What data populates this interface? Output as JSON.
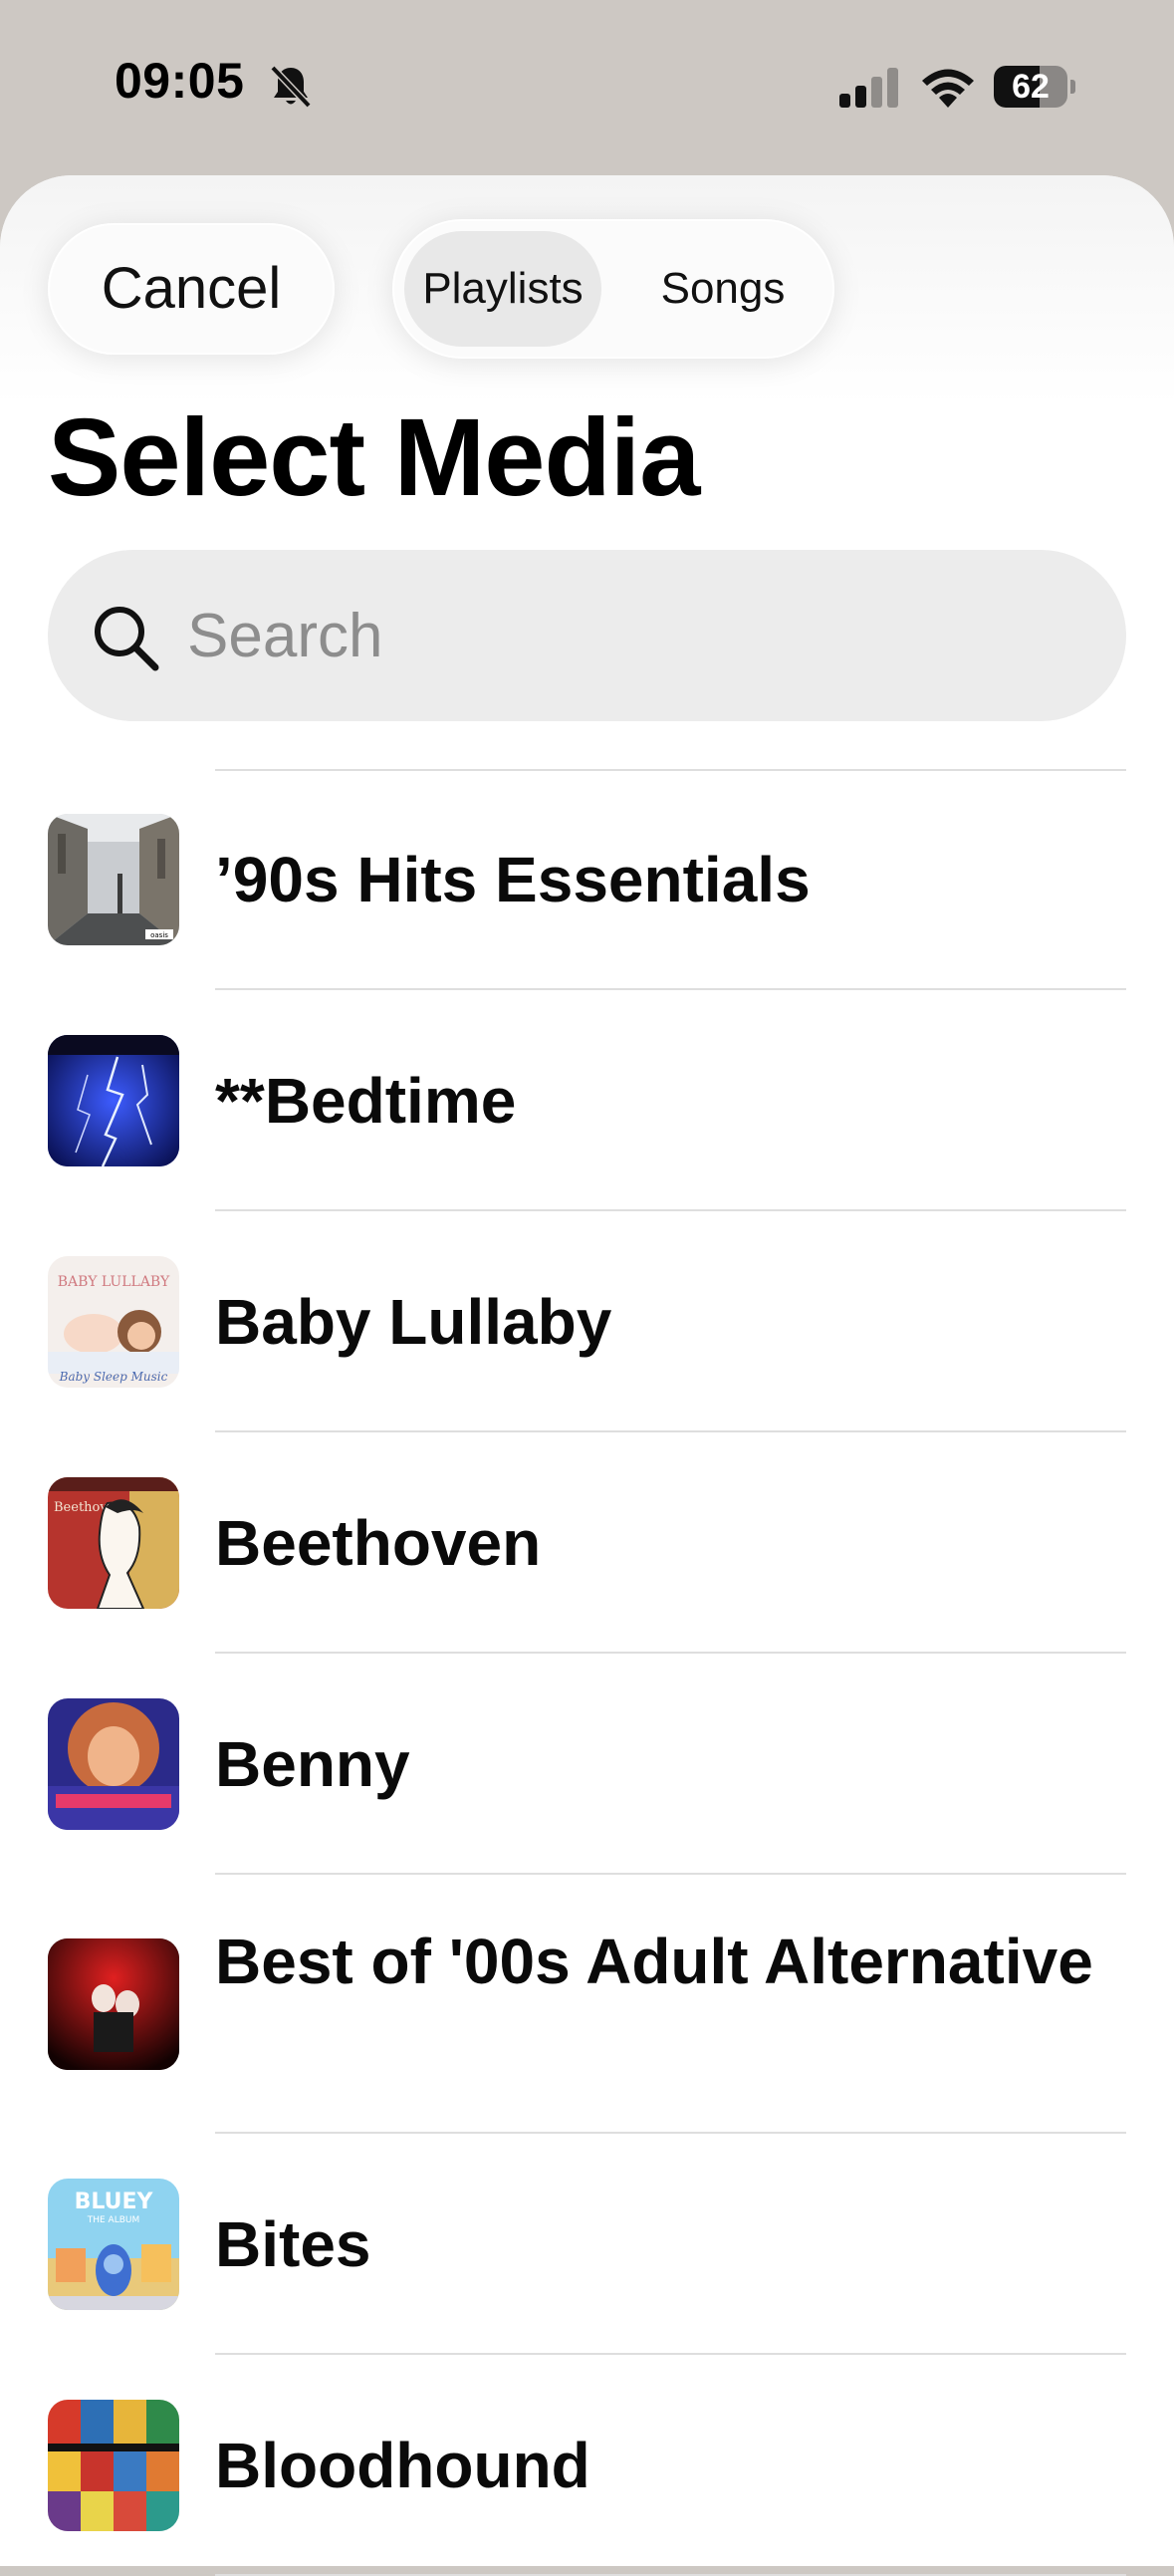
{
  "status_bar": {
    "time": "09:05",
    "battery_level": "62",
    "battery_fraction": 0.62,
    "icons": [
      "bell-slash-icon",
      "cellular-signal-icon",
      "wifi-icon",
      "battery-icon"
    ]
  },
  "header": {
    "cancel_label": "Cancel",
    "segments": [
      {
        "label": "Playlists",
        "selected": true
      },
      {
        "label": "Songs",
        "selected": false
      }
    ],
    "title": "Select Media"
  },
  "search": {
    "placeholder": "Search",
    "value": ""
  },
  "playlists": [
    {
      "title": "’90s Hits Essentials",
      "art": "city-street-photo"
    },
    {
      "title": "**Bedtime",
      "art": "lightning-storm"
    },
    {
      "title": "Baby Lullaby",
      "art": "sleeping-baby",
      "art_text": [
        "BABY LULLABY",
        "Baby Sleep Music"
      ]
    },
    {
      "title": "Beethoven",
      "art": "beethoven-illustration",
      "art_text": [
        "Beethoven"
      ]
    },
    {
      "title": "Benny",
      "art": "portrait-purple"
    },
    {
      "title": "Best of '00s Adult Alternative",
      "art": "red-black-photo"
    },
    {
      "title": "Bites",
      "art": "bluey-cartoon",
      "art_text": [
        "BLUEY",
        "THE ALBUM"
      ]
    },
    {
      "title": "Bloodhound",
      "art": "colorful-collage"
    }
  ],
  "colors": {
    "backdrop": "#cdc8c3",
    "sheet": "#ffffff",
    "search_field": "#ececec",
    "segment_selected": "#e8e8e8",
    "divider": "#dedede"
  }
}
